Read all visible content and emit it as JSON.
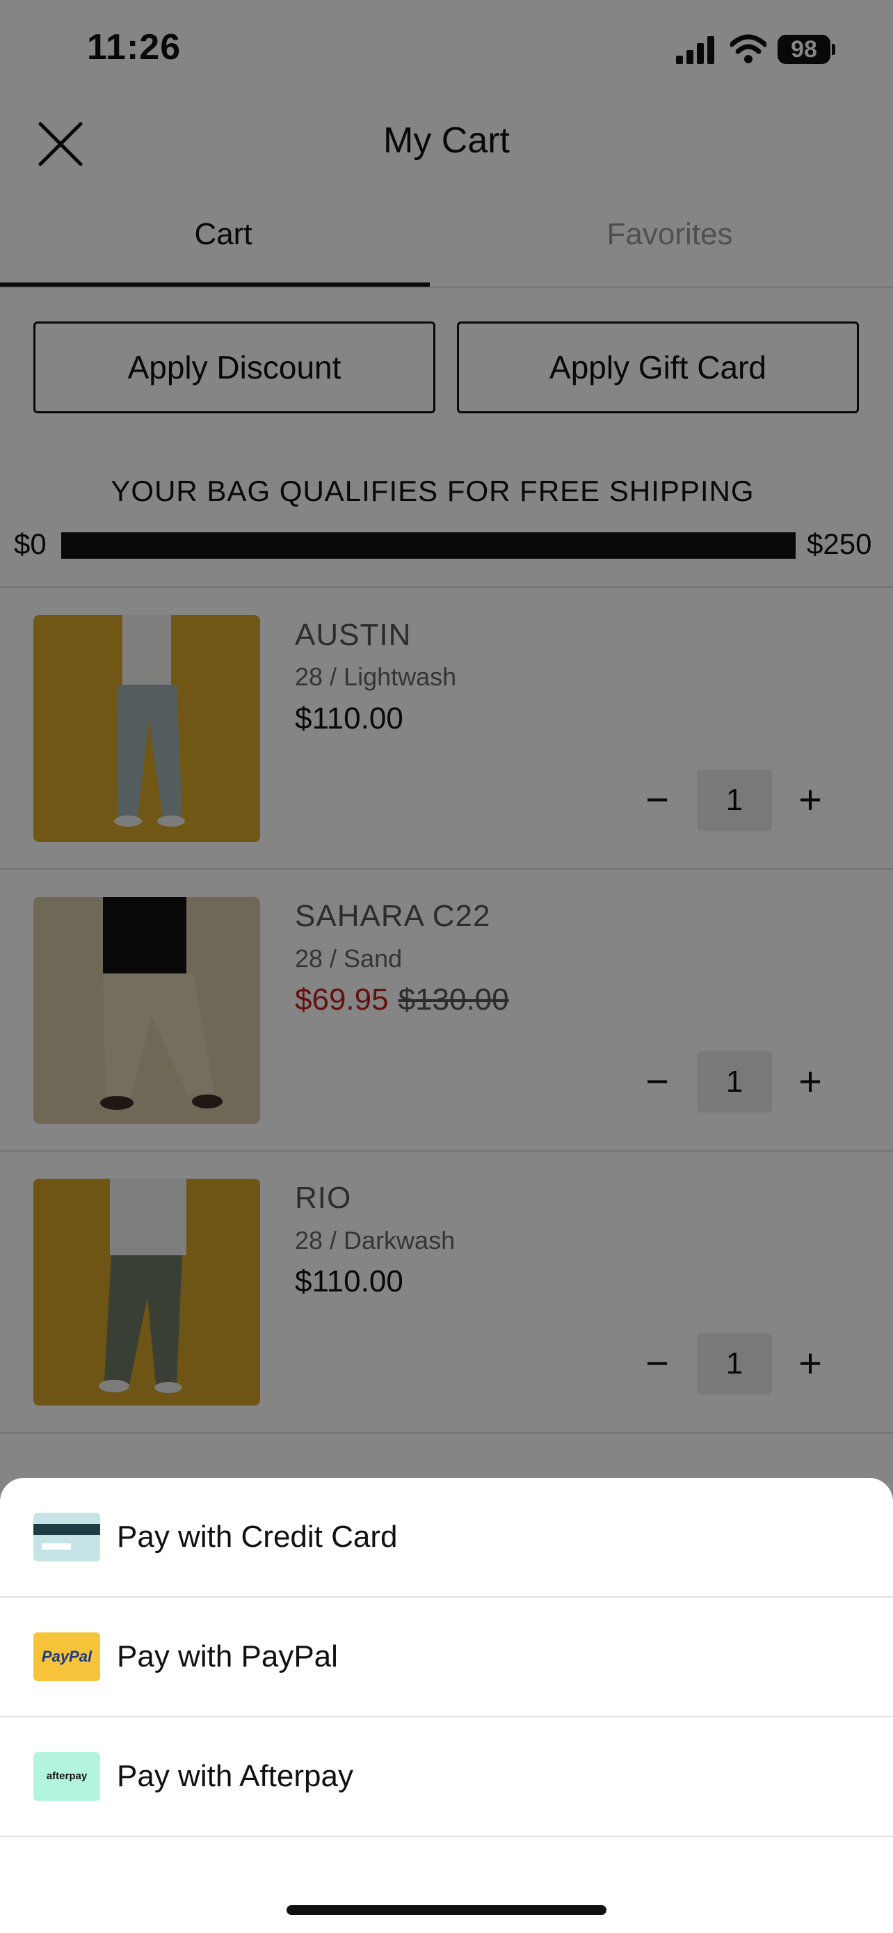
{
  "status_bar": {
    "time": "11:26",
    "battery": "98"
  },
  "header": {
    "title": "My Cart"
  },
  "tabs": [
    {
      "label": "Cart"
    },
    {
      "label": "Favorites"
    }
  ],
  "actions": {
    "discount": "Apply Discount",
    "gift_card": "Apply Gift Card"
  },
  "shipping": {
    "message": "YOUR BAG QUALIFIES FOR FREE SHIPPING",
    "min": "$0",
    "max": "$250",
    "progress": 1.0
  },
  "items": [
    {
      "name": "AUSTIN",
      "variant": "28 / Lightwash",
      "price": "$110.00",
      "qty": "1"
    },
    {
      "name": "SAHARA C22",
      "variant": "28 / Sand",
      "sale_price": "$69.95",
      "original_price": "$130.00",
      "qty": "1"
    },
    {
      "name": "RIO",
      "variant": "28 / Darkwash",
      "price": "$110.00",
      "qty": "1"
    }
  ],
  "qty_controls": {
    "minus": "−",
    "plus": "+"
  },
  "payment_sheet": [
    {
      "label": "Pay with Credit Card",
      "icon": "credit-card-icon"
    },
    {
      "label": "Pay with PayPal",
      "icon": "paypal-icon",
      "brand": "PayPal"
    },
    {
      "label": "Pay with Afterpay",
      "icon": "afterpay-icon",
      "brand": "afterpay"
    }
  ],
  "colors": {
    "sale": "#c0201e",
    "overlay": "rgba(0,0,0,0.48)",
    "paypal": "#f6c33a",
    "afterpay": "#b3f4dd",
    "card": "#c6e3e6"
  }
}
